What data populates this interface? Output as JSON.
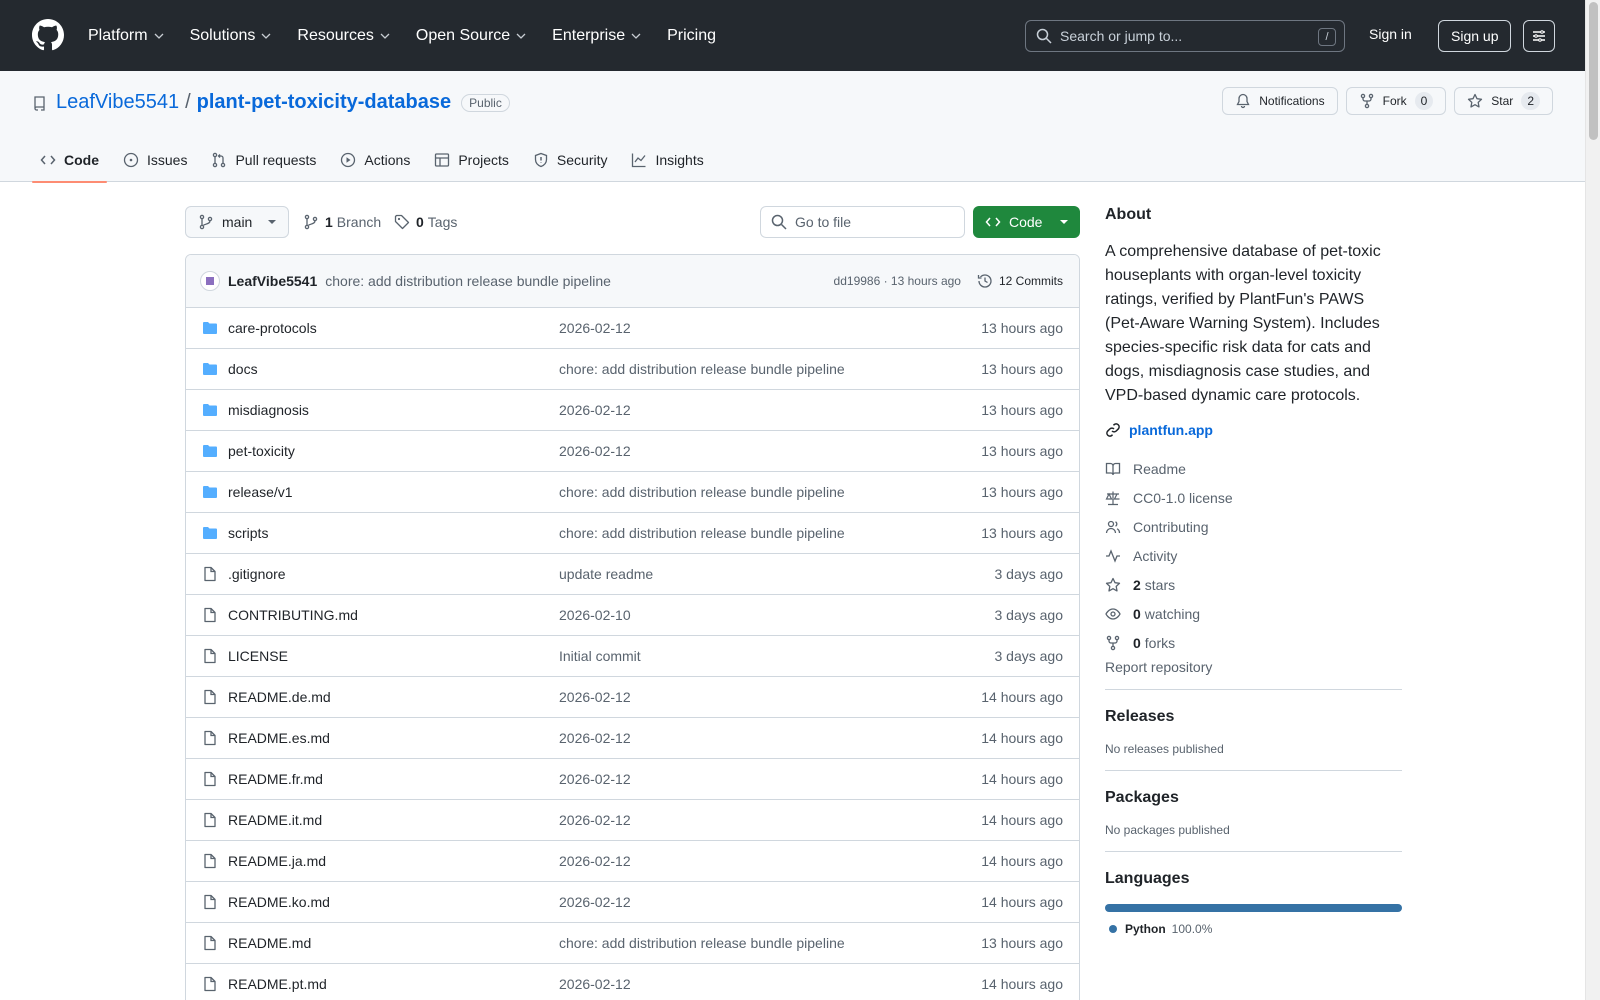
{
  "header": {
    "nav": [
      "Platform",
      "Solutions",
      "Resources",
      "Open Source",
      "Enterprise",
      "Pricing"
    ],
    "search_placeholder": "Search or jump to...",
    "search_shortcut": "/",
    "signin": "Sign in",
    "signup": "Sign up"
  },
  "repo": {
    "owner": "LeafVibe5541",
    "separator": "/",
    "name": "plant-pet-toxicity-database",
    "visibility": "Public",
    "notifications": "Notifications",
    "fork_label": "Fork",
    "fork_count": "0",
    "star_label": "Star",
    "star_count": "2"
  },
  "tabs": [
    "Code",
    "Issues",
    "Pull requests",
    "Actions",
    "Projects",
    "Security",
    "Insights"
  ],
  "toolbar": {
    "branch": "main",
    "branch_count": "1",
    "branch_label": "Branch",
    "tag_count": "0",
    "tag_label": "Tags",
    "goto_placeholder": "Go to file",
    "code_label": "Code"
  },
  "latest_commit": {
    "author": "LeafVibe5541",
    "message": "chore: add distribution release bundle pipeline",
    "sha_time": "dd19986 · 13 hours ago",
    "commits": "12 Commits"
  },
  "files": [
    {
      "name": "care-protocols",
      "type": "dir",
      "message": "2026-02-12",
      "date": "13 hours ago"
    },
    {
      "name": "docs",
      "type": "dir",
      "message": "chore: add distribution release bundle pipeline",
      "date": "13 hours ago"
    },
    {
      "name": "misdiagnosis",
      "type": "dir",
      "message": "2026-02-12",
      "date": "13 hours ago"
    },
    {
      "name": "pet-toxicity",
      "type": "dir",
      "message": "2026-02-12",
      "date": "13 hours ago"
    },
    {
      "name": "release/v1",
      "type": "dir",
      "message": "chore: add distribution release bundle pipeline",
      "date": "13 hours ago"
    },
    {
      "name": "scripts",
      "type": "dir",
      "message": "chore: add distribution release bundle pipeline",
      "date": "13 hours ago"
    },
    {
      "name": ".gitignore",
      "type": "file",
      "message": "update readme",
      "date": "3 days ago"
    },
    {
      "name": "CONTRIBUTING.md",
      "type": "file",
      "message": "2026-02-10",
      "date": "3 days ago"
    },
    {
      "name": "LICENSE",
      "type": "file",
      "message": "Initial commit",
      "date": "3 days ago"
    },
    {
      "name": "README.de.md",
      "type": "file",
      "message": "2026-02-12",
      "date": "14 hours ago"
    },
    {
      "name": "README.es.md",
      "type": "file",
      "message": "2026-02-12",
      "date": "14 hours ago"
    },
    {
      "name": "README.fr.md",
      "type": "file",
      "message": "2026-02-12",
      "date": "14 hours ago"
    },
    {
      "name": "README.it.md",
      "type": "file",
      "message": "2026-02-12",
      "date": "14 hours ago"
    },
    {
      "name": "README.ja.md",
      "type": "file",
      "message": "2026-02-12",
      "date": "14 hours ago"
    },
    {
      "name": "README.ko.md",
      "type": "file",
      "message": "2026-02-12",
      "date": "14 hours ago"
    },
    {
      "name": "README.md",
      "type": "file",
      "message": "chore: add distribution release bundle pipeline",
      "date": "13 hours ago"
    },
    {
      "name": "README.pt.md",
      "type": "file",
      "message": "2026-02-12",
      "date": "14 hours ago"
    }
  ],
  "about": {
    "title": "About",
    "description": "A comprehensive database of pet-toxic houseplants with organ-level toxicity ratings, verified by PlantFun's PAWS (Pet-Aware Warning System). Includes species-specific risk data for cats and dogs, misdiagnosis case studies, and VPD-based dynamic care protocols.",
    "website": "plantfun.app",
    "readme": "Readme",
    "license": "CC0-1.0 license",
    "contributing": "Contributing",
    "activity": "Activity",
    "stars_count": "2",
    "stars_label": "stars",
    "watching_count": "0",
    "watching_label": "watching",
    "forks_count": "0",
    "forks_label": "forks",
    "report": "Report repository"
  },
  "releases": {
    "title": "Releases",
    "empty": "No releases published"
  },
  "packages": {
    "title": "Packages",
    "empty": "No packages published"
  },
  "languages": {
    "title": "Languages",
    "name": "Python",
    "percent": "100.0%",
    "color": "#3572A5"
  }
}
